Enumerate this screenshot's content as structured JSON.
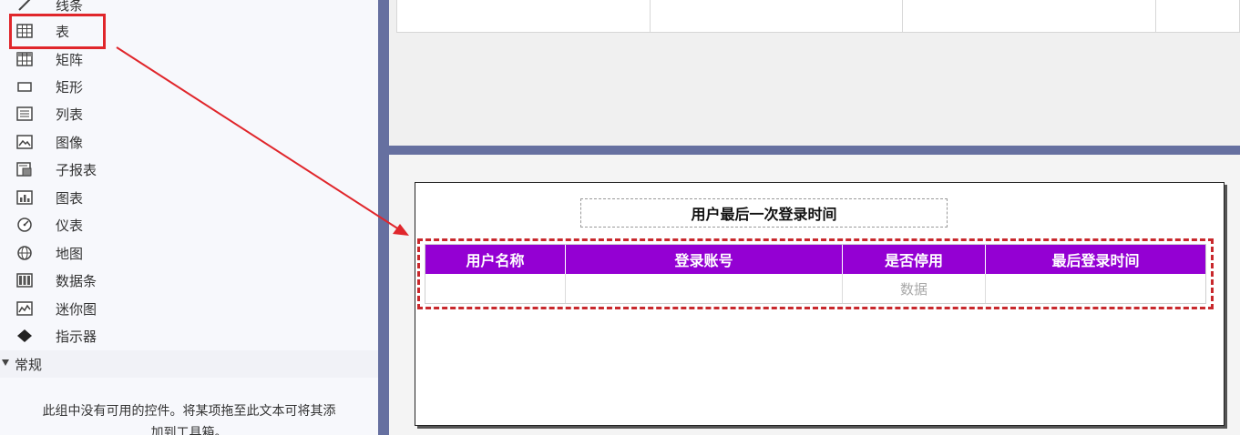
{
  "toolbox": {
    "items": [
      {
        "label": "线条",
        "icon": "line-icon"
      },
      {
        "label": "表",
        "icon": "table-icon"
      },
      {
        "label": "矩阵",
        "icon": "matrix-icon"
      },
      {
        "label": "矩形",
        "icon": "rectangle-icon"
      },
      {
        "label": "列表",
        "icon": "list-icon"
      },
      {
        "label": "图像",
        "icon": "image-icon"
      },
      {
        "label": "子报表",
        "icon": "subreport-icon"
      },
      {
        "label": "图表",
        "icon": "chart-icon"
      },
      {
        "label": "仪表",
        "icon": "gauge-icon"
      },
      {
        "label": "地图",
        "icon": "map-icon"
      },
      {
        "label": "数据条",
        "icon": "databar-icon"
      },
      {
        "label": "迷你图",
        "icon": "sparkline-icon"
      },
      {
        "label": "指示器",
        "icon": "indicator-icon"
      }
    ],
    "group_label": "常规",
    "empty_message_line1": "此组中没有可用的控件。将某项拖至此文本可将其添",
    "empty_message_line2": "加到工具箱。"
  },
  "report": {
    "title": "用户最后一次登录时间",
    "headers": [
      "用户名称",
      "登录账号",
      "是否停用",
      "最后登录时间"
    ],
    "row": [
      "",
      "",
      "数据",
      ""
    ]
  },
  "colors": {
    "header_bg": "#9400d3",
    "highlight": "#e0262b",
    "splitter": "#6670a0"
  }
}
